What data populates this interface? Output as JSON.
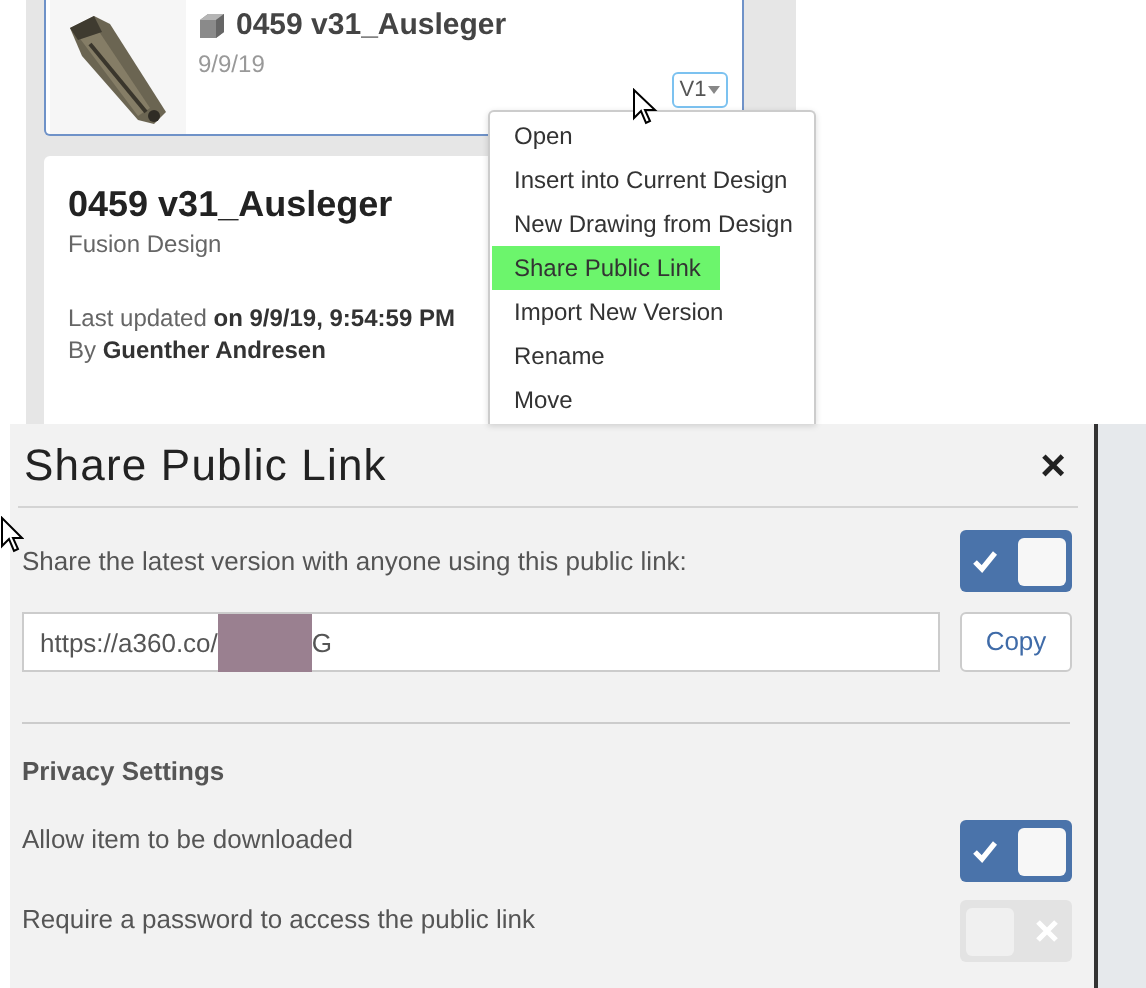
{
  "file_card": {
    "title": "0459 v31_Ausleger",
    "date": "9/9/19",
    "version": "V1"
  },
  "context_menu": {
    "items": [
      {
        "label": "Open",
        "selected": false
      },
      {
        "label": "Insert into Current Design",
        "selected": false
      },
      {
        "label": "New Drawing from Design",
        "selected": false
      },
      {
        "label": "Share Public Link",
        "selected": true
      },
      {
        "label": "Import New Version",
        "selected": false
      },
      {
        "label": "Rename",
        "selected": false
      },
      {
        "label": "Move",
        "selected": false
      }
    ]
  },
  "details": {
    "title": "0459 v31_Ausleger",
    "type": "Fusion Design",
    "updated_label": "Last updated",
    "updated_value": "on 9/9/19, 9:54:59 PM",
    "author_label": "By",
    "author": "Guenther Andresen"
  },
  "dialog": {
    "title": "Share Public Link",
    "close": "×",
    "share_text": "Share the latest version with anyone using this public link:",
    "share_on": true,
    "url_prefix": "https://a360.co/",
    "url_redacted": true,
    "url_suffix": "G",
    "copy": "Copy",
    "privacy_heading": "Privacy Settings",
    "settings": [
      {
        "label": "Allow item to be downloaded",
        "on": true
      },
      {
        "label": "Require a password to access the public link",
        "on": false
      }
    ]
  }
}
